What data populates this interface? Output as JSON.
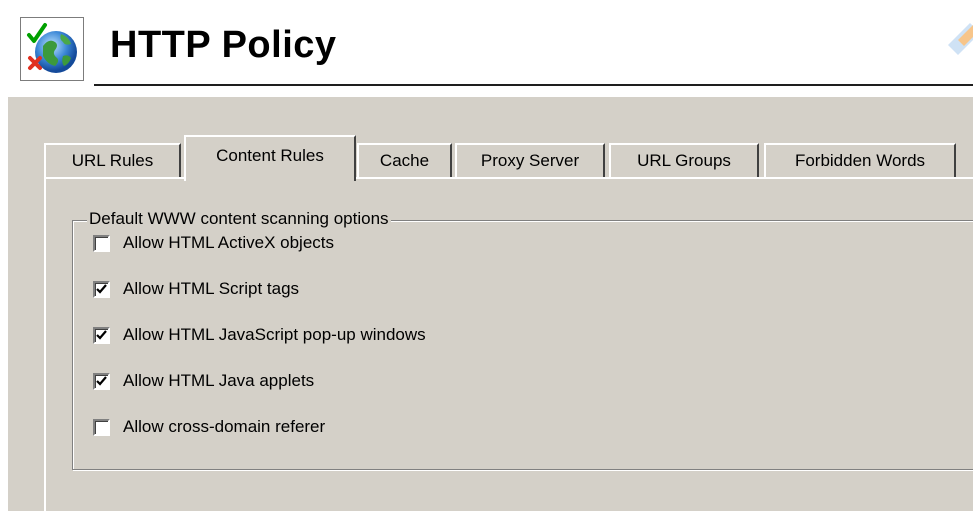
{
  "header": {
    "title": "HTTP Policy",
    "icon": "globe-check-icon"
  },
  "tabs": [
    {
      "label": "URL Rules",
      "active": false
    },
    {
      "label": "Content Rules",
      "active": true
    },
    {
      "label": "Cache",
      "active": false
    },
    {
      "label": "Proxy Server",
      "active": false
    },
    {
      "label": "URL Groups",
      "active": false
    },
    {
      "label": "Forbidden Words",
      "active": false
    }
  ],
  "group": {
    "legend": "Default WWW content scanning options",
    "options": [
      {
        "label": "Allow HTML ActiveX objects",
        "checked": false
      },
      {
        "label": "Allow HTML Script tags",
        "checked": true
      },
      {
        "label": "Allow HTML JavaScript pop-up windows",
        "checked": true
      },
      {
        "label": "Allow HTML Java applets",
        "checked": true
      },
      {
        "label": "Allow cross-domain referer",
        "checked": false
      }
    ]
  },
  "colors": {
    "panel": "#d4d0c8",
    "accent_check": "#00a000",
    "accent_cross": "#e03020"
  }
}
